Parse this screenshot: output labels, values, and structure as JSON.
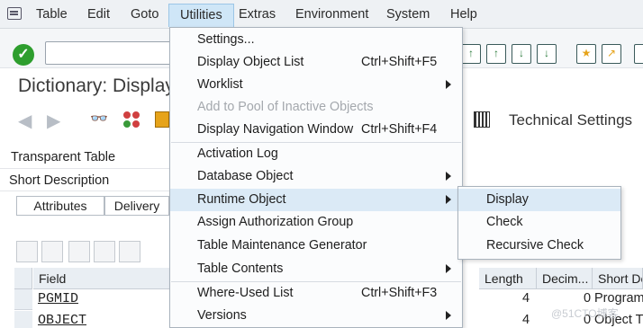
{
  "menubar": {
    "items": [
      "Table",
      "Edit",
      "Goto",
      "Utilities",
      "Extras",
      "Environment",
      "System",
      "Help"
    ],
    "active": "Utilities"
  },
  "page": {
    "title": "Dictionary: Display"
  },
  "app_toolbar": {
    "technical_settings": "Technical Settings"
  },
  "fields": {
    "transparent_table": "Transparent Table",
    "short_description": "Short Description"
  },
  "tabs": [
    "Attributes",
    "Delivery"
  ],
  "table": {
    "headers": [
      "Field",
      "Length",
      "Decim...",
      "Short De"
    ],
    "rows": [
      {
        "field": "PGMID",
        "length": "4",
        "decimals": "0",
        "short_desc": "Program"
      },
      {
        "field": "OBJECT",
        "length": "4",
        "decimals": "0",
        "short_desc": "Object T"
      }
    ]
  },
  "utilities_menu": {
    "items": [
      {
        "label": "Settings...",
        "shortcut": "",
        "submenu": false,
        "disabled": false
      },
      {
        "label": "Display Object List",
        "shortcut": "Ctrl+Shift+F5",
        "submenu": false,
        "disabled": false
      },
      {
        "label": "Worklist",
        "shortcut": "",
        "submenu": true,
        "disabled": false
      },
      {
        "label": "Add to Pool of Inactive Objects",
        "shortcut": "",
        "submenu": false,
        "disabled": true
      },
      {
        "label": "Display Navigation Window",
        "shortcut": "Ctrl+Shift+F4",
        "submenu": false,
        "disabled": false
      },
      {
        "label": "Activation Log",
        "shortcut": "",
        "submenu": false,
        "disabled": false
      },
      {
        "label": "Database Object",
        "shortcut": "",
        "submenu": true,
        "disabled": false
      },
      {
        "label": "Runtime Object",
        "shortcut": "",
        "submenu": true,
        "disabled": false
      },
      {
        "label": "Assign Authorization Group",
        "shortcut": "",
        "submenu": false,
        "disabled": false
      },
      {
        "label": "Table Maintenance Generator",
        "shortcut": "",
        "submenu": false,
        "disabled": false
      },
      {
        "label": "Table Contents",
        "shortcut": "",
        "submenu": true,
        "disabled": false
      },
      {
        "label": "Where-Used List",
        "shortcut": "Ctrl+Shift+F3",
        "submenu": false,
        "disabled": false
      },
      {
        "label": "Versions",
        "shortcut": "",
        "submenu": true,
        "disabled": false
      }
    ]
  },
  "runtime_submenu": {
    "items": [
      "Display",
      "Check",
      "Recursive Check"
    ]
  },
  "watermark": "@51CTO博客"
}
